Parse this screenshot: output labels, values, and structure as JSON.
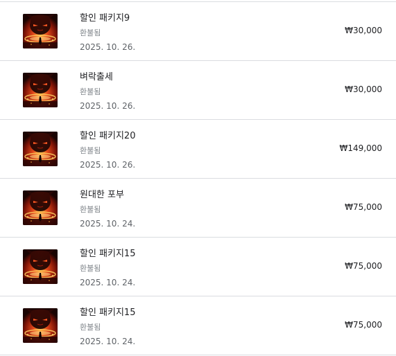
{
  "colors": {
    "divider": "#dadce0",
    "title": "#202124",
    "status": "#80868b",
    "date": "#5f6368",
    "thumb_dark": "#1a0402",
    "thumb_fire": "#e0461a",
    "thumb_glow": "#ffb13b"
  },
  "purchases": [
    {
      "title": "할인 패키지9",
      "status": "환불됨",
      "date": "2025. 10. 26.",
      "price": "₩30,000",
      "icon": "game-art-thumbnail"
    },
    {
      "title": "벼락출세",
      "status": "환불됨",
      "date": "2025. 10. 26.",
      "price": "₩30,000",
      "icon": "game-art-thumbnail"
    },
    {
      "title": "할인 패키지20",
      "status": "환불됨",
      "date": "2025. 10. 26.",
      "price": "₩149,000",
      "icon": "game-art-thumbnail"
    },
    {
      "title": "원대한 포부",
      "status": "환불됨",
      "date": "2025. 10. 24.",
      "price": "₩75,000",
      "icon": "game-art-thumbnail"
    },
    {
      "title": "할인 패키지15",
      "status": "환불됨",
      "date": "2025. 10. 24.",
      "price": "₩75,000",
      "icon": "game-art-thumbnail"
    },
    {
      "title": "할인 패키지15",
      "status": "환불됨",
      "date": "2025. 10. 24.",
      "price": "₩75,000",
      "icon": "game-art-thumbnail"
    }
  ]
}
